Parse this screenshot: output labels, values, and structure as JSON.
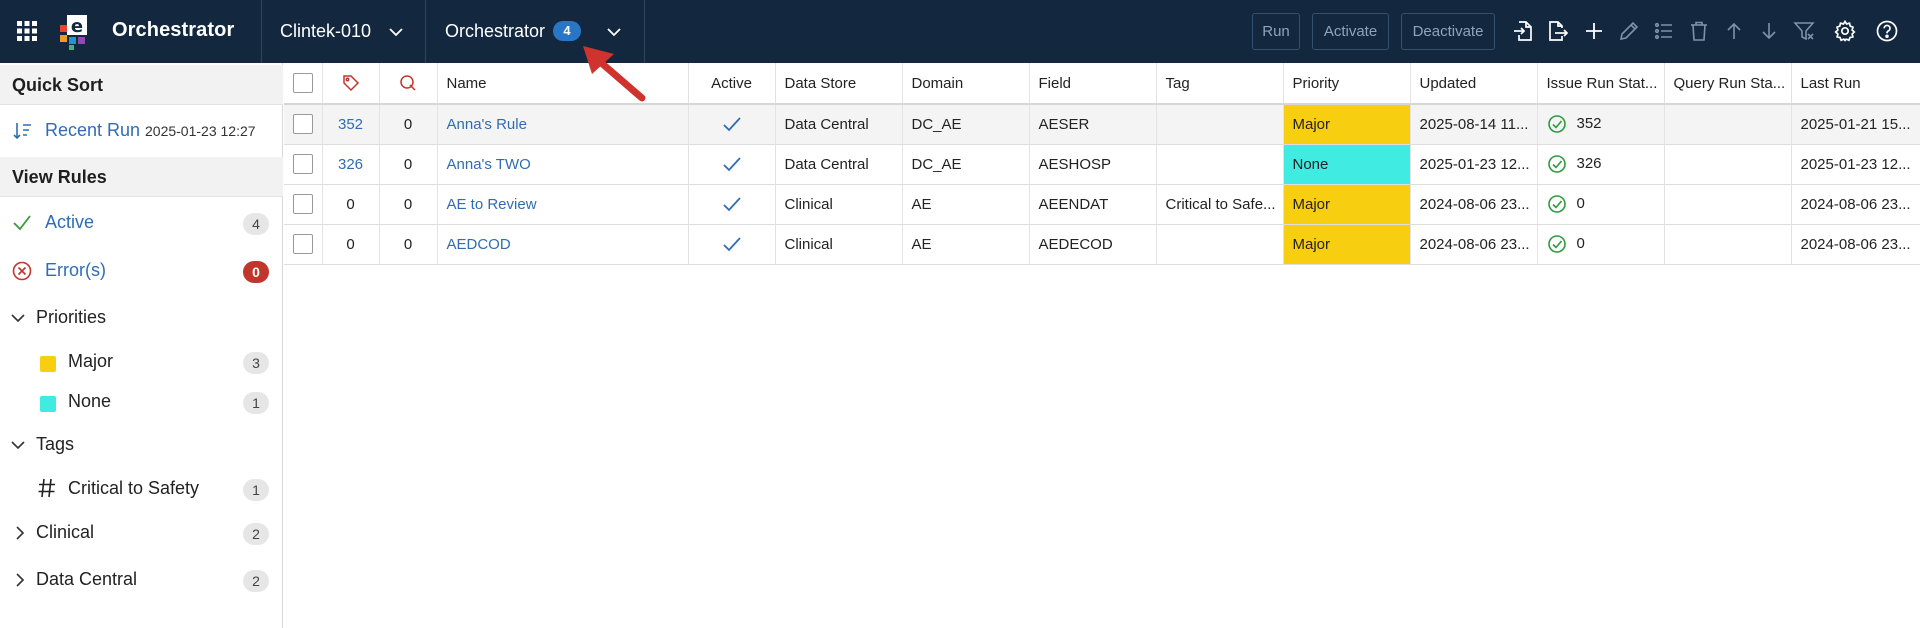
{
  "topbar": {
    "app_title": "Orchestrator",
    "study": "Clintek-010",
    "module": "Orchestrator",
    "module_count": "4",
    "buttons": {
      "run": "Run",
      "activate": "Activate",
      "deactivate": "Deactivate"
    }
  },
  "sidebar": {
    "quick_sort_title": "Quick Sort",
    "recent_run_label": "Recent Run",
    "recent_run_date": "2025-01-23 12:27",
    "view_rules_title": "View Rules",
    "active_label": "Active",
    "active_count": "4",
    "errors_label": "Error(s)",
    "errors_count": "0",
    "priorities_label": "Priorities",
    "priority_items": [
      {
        "label": "Major",
        "count": "3",
        "color": "#f8cf10"
      },
      {
        "label": "None",
        "count": "1",
        "color": "#40ebe1"
      }
    ],
    "tags_label": "Tags",
    "tag_items": [
      {
        "label": "Critical to Safety",
        "count": "1"
      }
    ],
    "groups": [
      {
        "label": "Clinical",
        "count": "2"
      },
      {
        "label": "Data Central",
        "count": "2"
      }
    ]
  },
  "table": {
    "columns": [
      "Name",
      "Active",
      "Data Store",
      "Domain",
      "Field",
      "Tag",
      "Priority",
      "Updated",
      "Issue Run Stat...",
      "Query Run Sta...",
      "Last Run"
    ],
    "rows": [
      {
        "issues": "352",
        "queries": "0",
        "name": "Anna's Rule",
        "data_store": "Data Central",
        "domain": "DC_AE",
        "field": "AESER",
        "tag": "",
        "priority": "Major",
        "updated": "2025-08-14 11...",
        "issue_status": "352",
        "query_status": "",
        "last_run": "2025-01-21 15..."
      },
      {
        "issues": "326",
        "queries": "0",
        "name": "Anna's TWO",
        "data_store": "Data Central",
        "domain": "DC_AE",
        "field": "AESHOSP",
        "tag": "",
        "priority": "None",
        "updated": "2025-01-23 12...",
        "issue_status": "326",
        "query_status": "",
        "last_run": "2025-01-23 12..."
      },
      {
        "issues": "0",
        "queries": "0",
        "name": "AE to Review",
        "data_store": "Clinical",
        "domain": "AE",
        "field": "AEENDAT",
        "tag": "Critical to Safe...",
        "priority": "Major",
        "updated": "2024-08-06 23...",
        "issue_status": "0",
        "query_status": "",
        "last_run": "2024-08-06 23..."
      },
      {
        "issues": "0",
        "queries": "0",
        "name": "AEDCOD",
        "data_store": "Clinical",
        "domain": "AE",
        "field": "AEDECOD",
        "tag": "",
        "priority": "Major",
        "updated": "2024-08-06 23...",
        "issue_status": "0",
        "query_status": "",
        "last_run": "2024-08-06 23..."
      }
    ]
  },
  "colors": {
    "topbar": "#13283f",
    "accent": "#2f6db3",
    "major": "#f8cf10",
    "none": "#40ebe1",
    "error": "#c0362c"
  }
}
